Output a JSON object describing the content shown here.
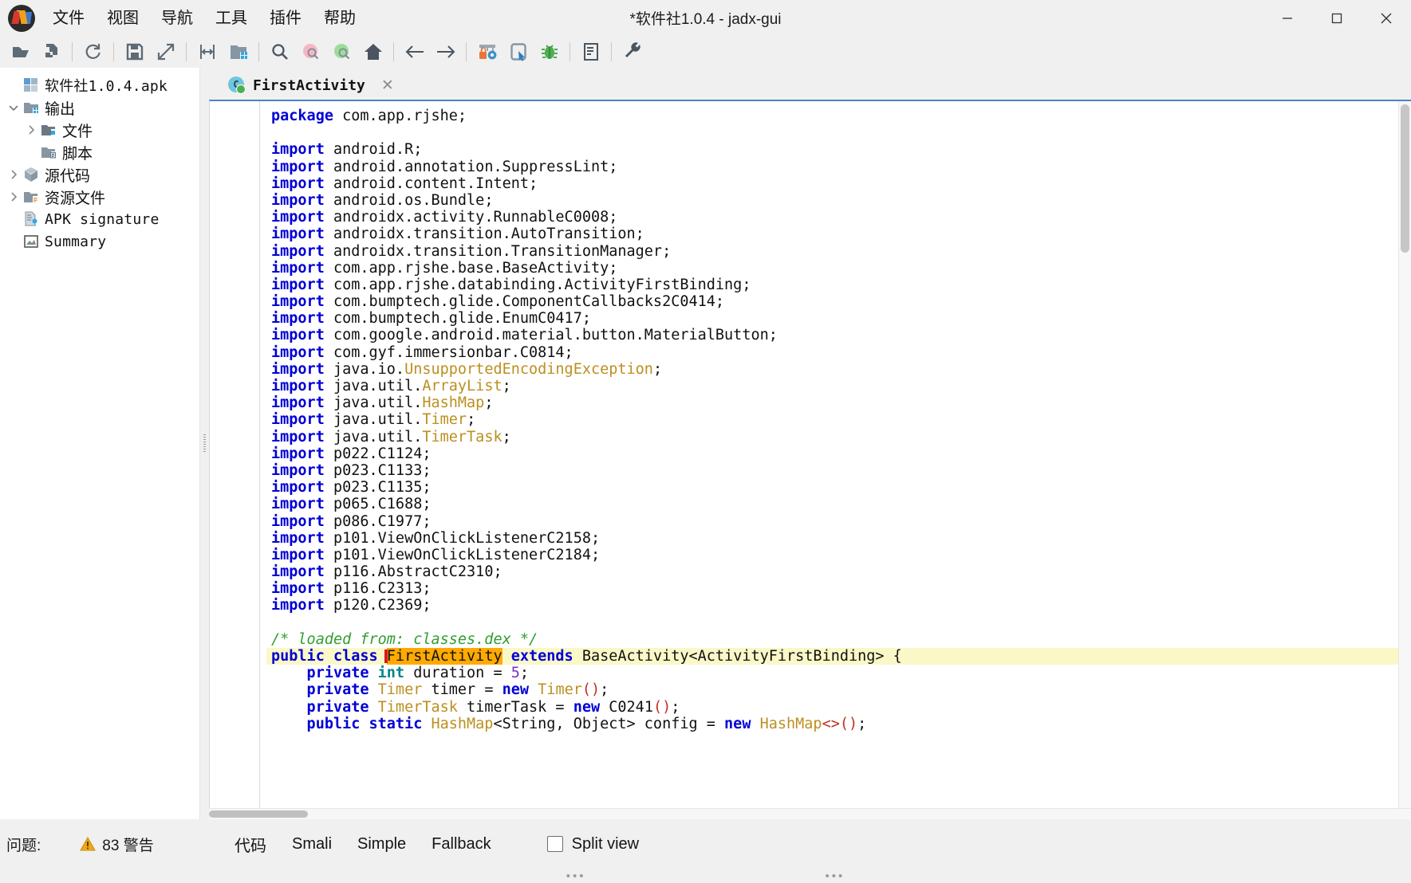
{
  "window": {
    "title": "*软件社1.0.4 - jadx-gui",
    "logo_icon": "jadx-logo-icon",
    "minimize_icon": "minimize-icon",
    "maximize_icon": "maximize-icon",
    "close_icon": "close-icon"
  },
  "menubar": {
    "items": [
      {
        "label": "文件",
        "name": "menu-file"
      },
      {
        "label": "视图",
        "name": "menu-view"
      },
      {
        "label": "导航",
        "name": "menu-navigation"
      },
      {
        "label": "工具",
        "name": "menu-tools"
      },
      {
        "label": "插件",
        "name": "menu-plugins"
      },
      {
        "label": "帮助",
        "name": "menu-help"
      }
    ]
  },
  "toolbar": {
    "buttons": [
      {
        "name": "open-file-button",
        "icon": "open-folder-icon"
      },
      {
        "name": "add-files-button",
        "icon": "file-add-icon"
      },
      {
        "name": "reload-button",
        "icon": "reload-icon"
      },
      {
        "name": "save-all-button",
        "icon": "save-icon"
      },
      {
        "name": "export-gradle-button",
        "icon": "export-icon"
      },
      {
        "name": "sync-button",
        "icon": "sync-arrows-icon"
      },
      {
        "name": "open-project-button",
        "icon": "folder-blue-icon"
      },
      {
        "name": "search-button",
        "icon": "search-icon"
      },
      {
        "name": "class-search-button",
        "icon": "search-pink-icon"
      },
      {
        "name": "method-search-button",
        "icon": "search-green-icon"
      },
      {
        "name": "home-button",
        "icon": "home-icon"
      },
      {
        "name": "back-button",
        "icon": "arrow-left-icon"
      },
      {
        "name": "forward-button",
        "icon": "arrow-right-icon"
      },
      {
        "name": "deobfuscation-button",
        "icon": "lock-gear-icon"
      },
      {
        "name": "quark-button",
        "icon": "device-cursor-icon"
      },
      {
        "name": "debugger-button",
        "icon": "bug-icon"
      },
      {
        "name": "logs-button",
        "icon": "log-viewer-icon"
      },
      {
        "name": "preferences-button",
        "icon": "wrench-icon"
      }
    ]
  },
  "sidebar": {
    "tree": [
      {
        "label": "软件社1.0.4.apk",
        "icon": "apk-icon",
        "indent": 0,
        "twisty": "none",
        "mono": false,
        "name": "tree-item-apk-root"
      },
      {
        "label": "输出",
        "icon": "folder-output-icon",
        "indent": 1,
        "twisty": "expanded",
        "mono": false,
        "name": "tree-item-output"
      },
      {
        "label": "文件",
        "icon": "folder-files-icon",
        "indent": 2,
        "twisty": "collapsed",
        "mono": false,
        "name": "tree-item-files"
      },
      {
        "label": "脚本",
        "icon": "folder-scripts-icon",
        "indent": 2,
        "twisty": "none",
        "mono": false,
        "name": "tree-item-scripts"
      },
      {
        "label": "源代码",
        "icon": "package-icon",
        "indent": 1,
        "twisty": "collapsed",
        "mono": false,
        "name": "tree-item-source-code"
      },
      {
        "label": "资源文件",
        "icon": "folder-resources-icon",
        "indent": 1,
        "twisty": "collapsed",
        "mono": false,
        "name": "tree-item-resources"
      },
      {
        "label": "APK signature",
        "icon": "signature-icon",
        "indent": 1,
        "twisty": "none",
        "mono": true,
        "name": "tree-item-apk-signature"
      },
      {
        "label": "Summary",
        "icon": "summary-icon",
        "indent": 1,
        "twisty": "none",
        "mono": true,
        "name": "tree-item-summary"
      }
    ]
  },
  "editor": {
    "tab": {
      "label": "FirstActivity",
      "class_icon": "java-class-icon",
      "close_icon": "close-tab-icon"
    },
    "code_lines": [
      [
        {
          "t": "package ",
          "c": "kw"
        },
        {
          "t": "com.app.rjshe;",
          "c": ""
        }
      ],
      [],
      [
        {
          "t": "import ",
          "c": "kw"
        },
        {
          "t": "android.R;",
          "c": ""
        }
      ],
      [
        {
          "t": "import ",
          "c": "kw"
        },
        {
          "t": "android.annotation.SuppressLint;",
          "c": ""
        }
      ],
      [
        {
          "t": "import ",
          "c": "kw"
        },
        {
          "t": "android.content.Intent;",
          "c": ""
        }
      ],
      [
        {
          "t": "import ",
          "c": "kw"
        },
        {
          "t": "android.os.Bundle;",
          "c": ""
        }
      ],
      [
        {
          "t": "import ",
          "c": "kw"
        },
        {
          "t": "androidx.activity.RunnableC0008;",
          "c": ""
        }
      ],
      [
        {
          "t": "import ",
          "c": "kw"
        },
        {
          "t": "androidx.transition.AutoTransition;",
          "c": ""
        }
      ],
      [
        {
          "t": "import ",
          "c": "kw"
        },
        {
          "t": "androidx.transition.TransitionManager;",
          "c": ""
        }
      ],
      [
        {
          "t": "import ",
          "c": "kw"
        },
        {
          "t": "com.app.rjshe.base.BaseActivity;",
          "c": ""
        }
      ],
      [
        {
          "t": "import ",
          "c": "kw"
        },
        {
          "t": "com.app.rjshe.databinding.ActivityFirstBinding;",
          "c": ""
        }
      ],
      [
        {
          "t": "import ",
          "c": "kw"
        },
        {
          "t": "com.bumptech.glide.ComponentCallbacks2C0414;",
          "c": ""
        }
      ],
      [
        {
          "t": "import ",
          "c": "kw"
        },
        {
          "t": "com.bumptech.glide.EnumC0417;",
          "c": ""
        }
      ],
      [
        {
          "t": "import ",
          "c": "kw"
        },
        {
          "t": "com.google.android.material.button.MaterialButton;",
          "c": ""
        }
      ],
      [
        {
          "t": "import ",
          "c": "kw"
        },
        {
          "t": "com.gyf.immersionbar.C0814;",
          "c": ""
        }
      ],
      [
        {
          "t": "import ",
          "c": "kw"
        },
        {
          "t": "java.io.",
          "c": ""
        },
        {
          "t": "UnsupportedEncodingException",
          "c": "typ"
        },
        {
          "t": ";",
          "c": ""
        }
      ],
      [
        {
          "t": "import ",
          "c": "kw"
        },
        {
          "t": "java.util.",
          "c": ""
        },
        {
          "t": "ArrayList",
          "c": "typ"
        },
        {
          "t": ";",
          "c": ""
        }
      ],
      [
        {
          "t": "import ",
          "c": "kw"
        },
        {
          "t": "java.util.",
          "c": ""
        },
        {
          "t": "HashMap",
          "c": "typ"
        },
        {
          "t": ";",
          "c": ""
        }
      ],
      [
        {
          "t": "import ",
          "c": "kw"
        },
        {
          "t": "java.util.",
          "c": ""
        },
        {
          "t": "Timer",
          "c": "typ"
        },
        {
          "t": ";",
          "c": ""
        }
      ],
      [
        {
          "t": "import ",
          "c": "kw"
        },
        {
          "t": "java.util.",
          "c": ""
        },
        {
          "t": "TimerTask",
          "c": "typ"
        },
        {
          "t": ";",
          "c": ""
        }
      ],
      [
        {
          "t": "import ",
          "c": "kw"
        },
        {
          "t": "p022.C1124;",
          "c": ""
        }
      ],
      [
        {
          "t": "import ",
          "c": "kw"
        },
        {
          "t": "p023.C1133;",
          "c": ""
        }
      ],
      [
        {
          "t": "import ",
          "c": "kw"
        },
        {
          "t": "p023.C1135;",
          "c": ""
        }
      ],
      [
        {
          "t": "import ",
          "c": "kw"
        },
        {
          "t": "p065.C1688;",
          "c": ""
        }
      ],
      [
        {
          "t": "import ",
          "c": "kw"
        },
        {
          "t": "p086.C1977;",
          "c": ""
        }
      ],
      [
        {
          "t": "import ",
          "c": "kw"
        },
        {
          "t": "p101.ViewOnClickListenerC2158;",
          "c": ""
        }
      ],
      [
        {
          "t": "import ",
          "c": "kw"
        },
        {
          "t": "p101.ViewOnClickListenerC2184;",
          "c": ""
        }
      ],
      [
        {
          "t": "import ",
          "c": "kw"
        },
        {
          "t": "p116.AbstractC2310;",
          "c": ""
        }
      ],
      [
        {
          "t": "import ",
          "c": "kw"
        },
        {
          "t": "p116.C2313;",
          "c": ""
        }
      ],
      [
        {
          "t": "import ",
          "c": "kw"
        },
        {
          "t": "p120.C2369;",
          "c": ""
        }
      ],
      [],
      [
        {
          "t": "/* loaded from: classes.dex */",
          "c": "cmt"
        }
      ],
      [
        {
          "t": "public class ",
          "c": "kw"
        },
        {
          "t": "FirstActivity",
          "c": "sel-caret"
        },
        {
          "t": " extends ",
          "c": "kw"
        },
        {
          "t": "BaseActivity<ActivityFirstBinding> ",
          "c": ""
        },
        {
          "t": "{",
          "c": ""
        }
      ],
      [
        {
          "t": "    private ",
          "c": "kw"
        },
        {
          "t": "int",
          "c": "prim"
        },
        {
          "t": " duration = ",
          "c": ""
        },
        {
          "t": "5",
          "c": "num"
        },
        {
          "t": ";",
          "c": ""
        }
      ],
      [
        {
          "t": "    private ",
          "c": "kw"
        },
        {
          "t": "Timer",
          "c": "typ"
        },
        {
          "t": " timer = ",
          "c": ""
        },
        {
          "t": "new ",
          "c": "kw"
        },
        {
          "t": "Timer",
          "c": "typ"
        },
        {
          "t": "()",
          "c": "paren"
        },
        {
          "t": ";",
          "c": ""
        }
      ],
      [
        {
          "t": "    private ",
          "c": "kw"
        },
        {
          "t": "TimerTask",
          "c": "typ"
        },
        {
          "t": " timerTask = ",
          "c": ""
        },
        {
          "t": "new ",
          "c": "kw"
        },
        {
          "t": "C0241",
          "c": ""
        },
        {
          "t": "()",
          "c": "paren"
        },
        {
          "t": ";",
          "c": ""
        }
      ],
      [
        {
          "t": "    public static ",
          "c": "kw"
        },
        {
          "t": "HashMap",
          "c": "typ"
        },
        {
          "t": "<String, Object> config = ",
          "c": ""
        },
        {
          "t": "new ",
          "c": "kw"
        },
        {
          "t": "HashMap",
          "c": "typ"
        },
        {
          "t": "<>()",
          "c": "paren"
        },
        {
          "t": ";",
          "c": ""
        }
      ]
    ],
    "highlighted_line_index": 32,
    "selection_text": "FirstActivity"
  },
  "bottom": {
    "status_label": "问题:",
    "warning_icon": "warning-triangle-icon",
    "warning_text": "83 警告",
    "view_tabs": [
      {
        "label": "代码",
        "name": "tab-code",
        "active": true
      },
      {
        "label": "Smali",
        "name": "tab-smali",
        "active": false
      },
      {
        "label": "Simple",
        "name": "tab-simple",
        "active": false
      },
      {
        "label": "Fallback",
        "name": "tab-fallback",
        "active": false
      }
    ],
    "split_view_label": "Split view",
    "split_view_checked": false,
    "grip_dots": "•••"
  },
  "colors": {
    "keyword": "#0000d6",
    "type": "#bc8f20",
    "comment": "#2f9e2f",
    "number": "#7b2fbf",
    "primitive": "#008585",
    "selection_bg": "#ffaa00",
    "line_highlight_bg": "#fbf8c8",
    "caret": "#d81b1b",
    "accent_tab_border": "#4a84c8"
  }
}
